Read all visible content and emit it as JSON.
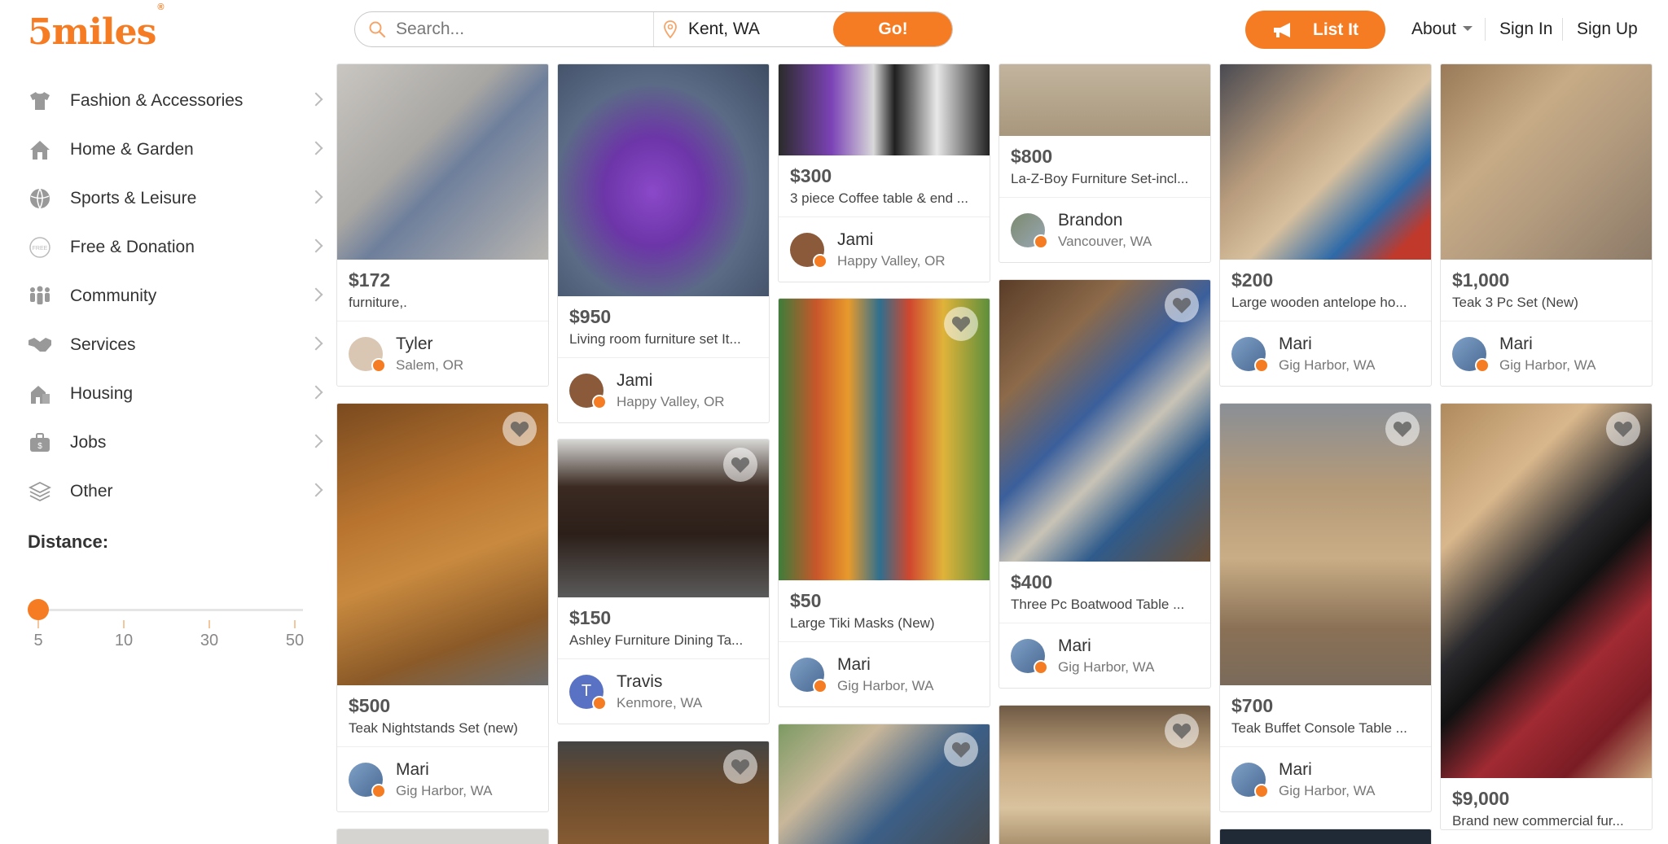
{
  "brand": {
    "logo_text": "5miles",
    "reg_mark": "®",
    "accent": "#f57c23"
  },
  "search": {
    "placeholder": "Search...",
    "location": "Kent, WA",
    "go_label": "Go!"
  },
  "header": {
    "list_it_label": "List It",
    "about_label": "About",
    "signin_label": "Sign In",
    "signup_label": "Sign Up"
  },
  "sidebar": {
    "categories": [
      {
        "label": "Fashion & Accessories",
        "icon": "shirt-icon"
      },
      {
        "label": "Home & Garden",
        "icon": "house-icon"
      },
      {
        "label": "Sports & Leisure",
        "icon": "ball-icon"
      },
      {
        "label": "Free & Donation",
        "icon": "free-icon"
      },
      {
        "label": "Community",
        "icon": "people-icon"
      },
      {
        "label": "Services",
        "icon": "handshake-icon"
      },
      {
        "label": "Housing",
        "icon": "building-icon"
      },
      {
        "label": "Jobs",
        "icon": "briefcase-icon"
      },
      {
        "label": "Other",
        "icon": "layers-icon"
      }
    ],
    "distance_title": "Distance:",
    "distance_options": [
      "5",
      "10",
      "30",
      "50"
    ],
    "distance_selected": "5"
  },
  "listings": [
    {
      "price": "$172",
      "title": "furniture,.",
      "seller": "Tyler",
      "location": "Salem, OR"
    },
    {
      "price": "$500",
      "title": "Teak Nightstands Set (new)",
      "seller": "Mari",
      "location": "Gig Harbor, WA"
    },
    {
      "price": "$950",
      "title": "Living room furniture set It...",
      "seller": "Jami",
      "location": "Happy Valley, OR"
    },
    {
      "price": "$150",
      "title": "Ashley Furniture Dining Ta...",
      "seller": "Travis",
      "location": "Kenmore, WA",
      "avatar_letter": "T"
    },
    {
      "price": "$300",
      "title": "3 piece Coffee table & end ...",
      "seller": "Jami",
      "location": "Happy Valley, OR"
    },
    {
      "price": "$50",
      "title": "Large Tiki Masks (New)",
      "seller": "Mari",
      "location": "Gig Harbor, WA"
    },
    {
      "price": "$800",
      "title": "La-Z-Boy Furniture Set-incl...",
      "seller": "Brandon",
      "location": "Vancouver, WA"
    },
    {
      "price": "$400",
      "title": "Three Pc Boatwood Table ...",
      "seller": "Mari",
      "location": "Gig Harbor, WA"
    },
    {
      "price": "$200",
      "title": "Large wooden antelope ho...",
      "seller": "Mari",
      "location": "Gig Harbor, WA"
    },
    {
      "price": "$700",
      "title": "Teak Buffet Console Table ...",
      "seller": "Mari",
      "location": "Gig Harbor, WA"
    },
    {
      "price": "$1,000",
      "title": "Teak 3 Pc Set (New)",
      "seller": "Mari",
      "location": "Gig Harbor, WA"
    },
    {
      "price": "$9,000",
      "title": "Brand new commercial fur..."
    }
  ]
}
